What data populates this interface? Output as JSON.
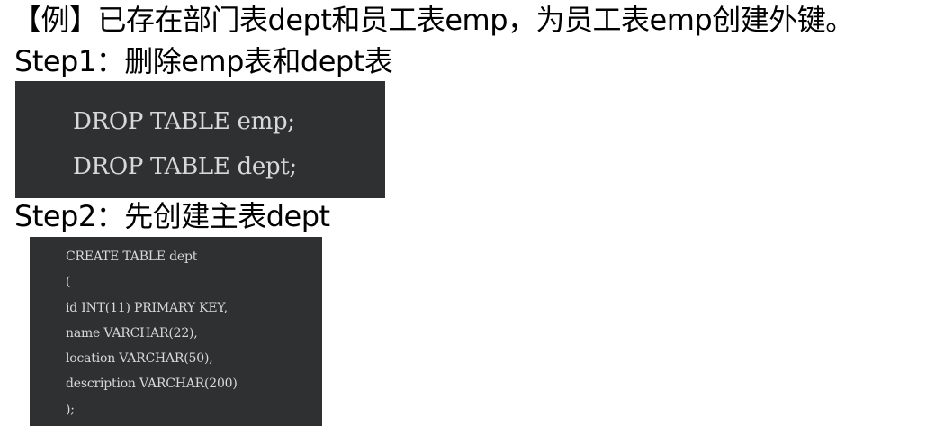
{
  "title": "【例】已存在部门表dept和员工表emp，为员工表emp创建外键。",
  "step1": {
    "heading": "Step1：删除emp表和dept表",
    "code_lines": [
      "DROP TABLE emp;",
      "DROP TABLE dept;"
    ]
  },
  "step2": {
    "heading": "Step2：先创建主表dept",
    "code_lines": [
      "CREATE TABLE dept",
      "(",
      "id INT(11) PRIMARY KEY,",
      "name VARCHAR(22),",
      "location VARCHAR(50),",
      "description VARCHAR(200)",
      ");"
    ]
  },
  "colors": {
    "code_background": "#2f3032",
    "code_text": "#d8d8d8",
    "page_background": "#ffffff",
    "text": "#000000"
  }
}
